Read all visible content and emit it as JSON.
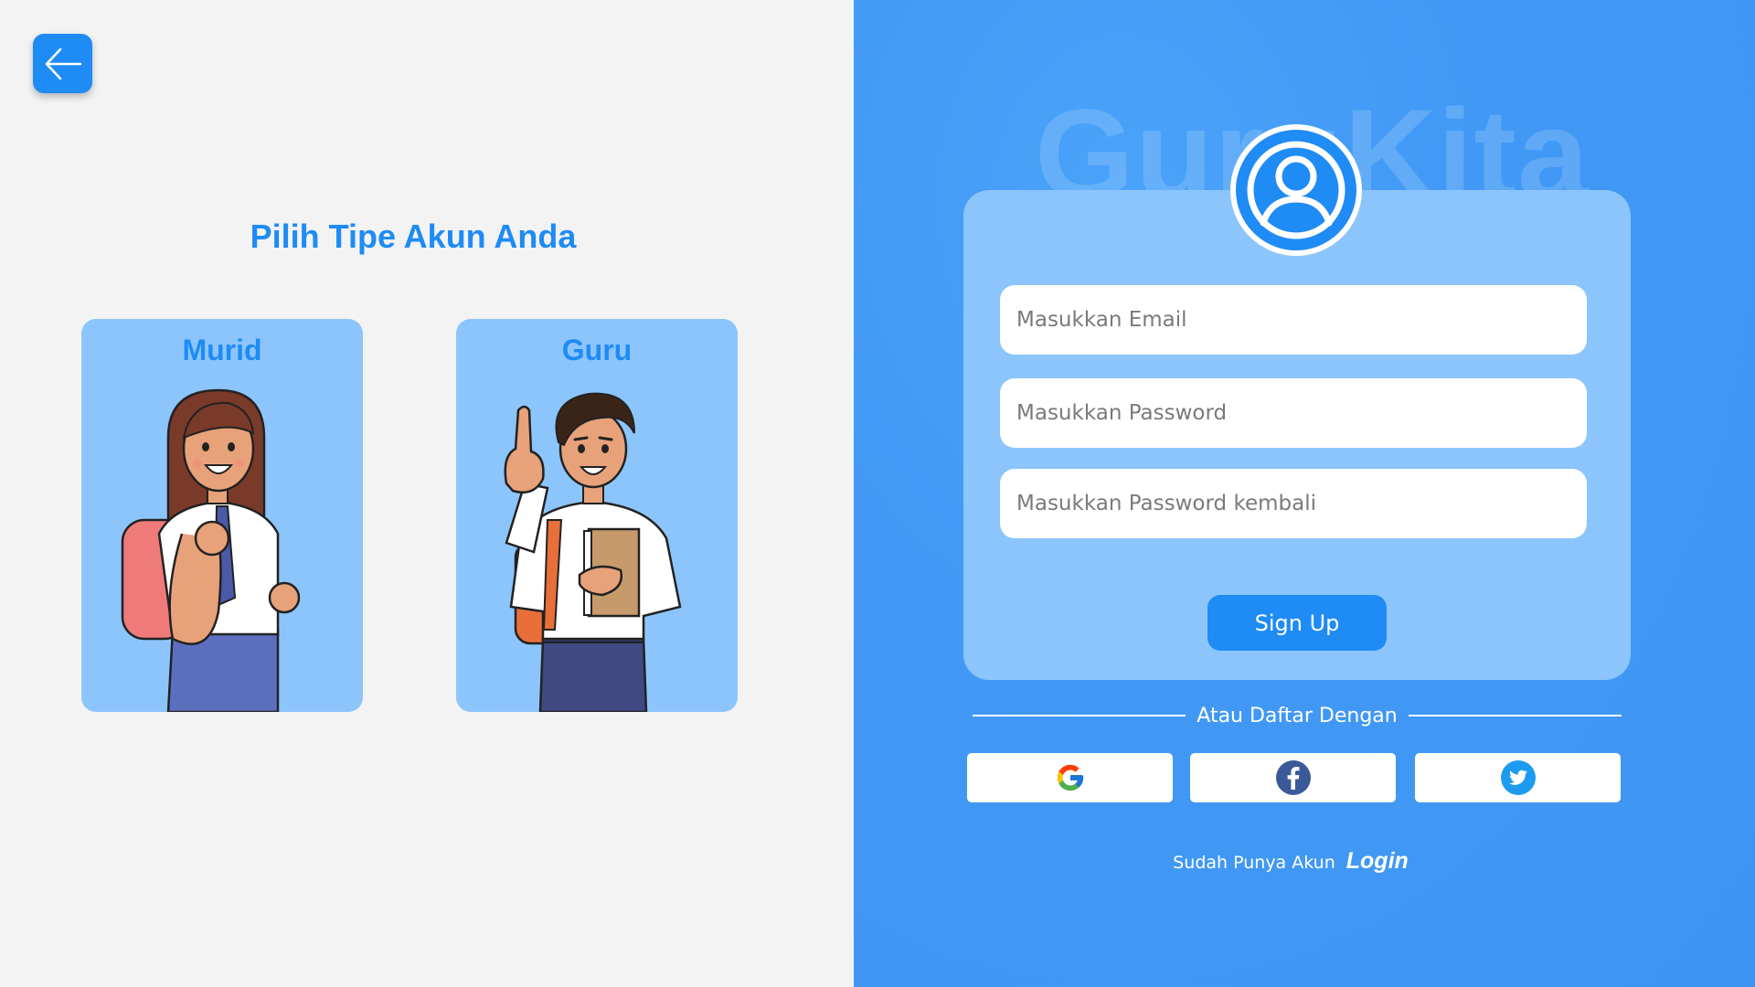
{
  "header": {
    "back_icon": "arrow-left-icon"
  },
  "account_type": {
    "title": "Pilih Tipe Akun Anda",
    "options": [
      {
        "label": "Murid",
        "illustration": "student-girl-illustration"
      },
      {
        "label": "Guru",
        "illustration": "teacher-man-illustration"
      }
    ]
  },
  "brand": {
    "watermark": "GuruKita",
    "avatar_icon": "user-avatar-icon"
  },
  "form": {
    "email_placeholder": "Masukkan Email",
    "password_placeholder": "Masukkan Password",
    "password_confirm_placeholder": "Masukkan Password kembali",
    "submit_label": "Sign Up"
  },
  "social": {
    "divider_text": "Atau Daftar Dengan",
    "providers": [
      "google-icon",
      "facebook-icon",
      "twitter-icon"
    ]
  },
  "footer": {
    "prompt": "Sudah Punya Akun",
    "login_label": "Login"
  },
  "colors": {
    "primary": "#1f8bf5",
    "card": "#8cc5fb",
    "right_bg": "#4199f5",
    "left_bg": "#f3f3f3"
  }
}
